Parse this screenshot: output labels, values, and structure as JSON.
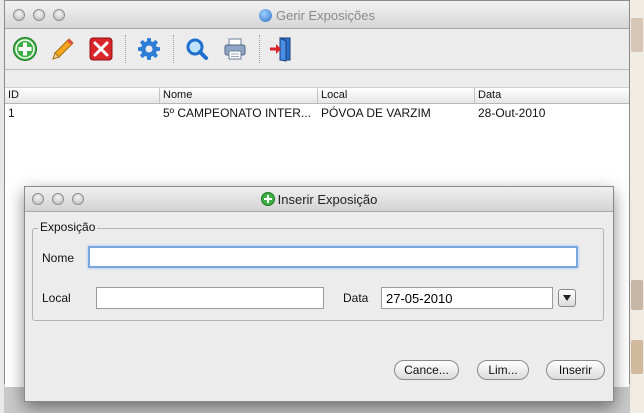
{
  "main_window": {
    "title": "Gerir Exposições",
    "toolbar": [
      {
        "name": "add-button",
        "icon": "add-icon"
      },
      {
        "name": "edit-button",
        "icon": "pencil-icon"
      },
      {
        "name": "delete-button",
        "icon": "delete-icon"
      },
      {
        "name": "settings-button",
        "icon": "gear-icon"
      },
      {
        "name": "search-button",
        "icon": "search-icon"
      },
      {
        "name": "print-button",
        "icon": "printer-icon"
      },
      {
        "name": "exit-button",
        "icon": "exit-door-icon"
      }
    ],
    "table": {
      "columns": [
        "ID",
        "Nome",
        "Local",
        "Data"
      ],
      "rows": [
        [
          "1",
          "5º CAMPEONATO INTER...",
          "PÓVOA DE VARZIM",
          "28-Out-2010"
        ]
      ]
    }
  },
  "dialog": {
    "title": "Inserir Exposição",
    "group_label": "Exposição",
    "nome_label": "Nome",
    "nome_value": "",
    "local_label": "Local",
    "local_value": "",
    "data_label": "Data",
    "data_value": "27-05-2010",
    "buttons": {
      "cancel": "Cance...",
      "clear": "Lim...",
      "insert": "Inserir"
    }
  },
  "colors": {
    "focus_ring": "#7aa7e0",
    "add_green": "#3cb043",
    "delete_red": "#d8262b"
  }
}
